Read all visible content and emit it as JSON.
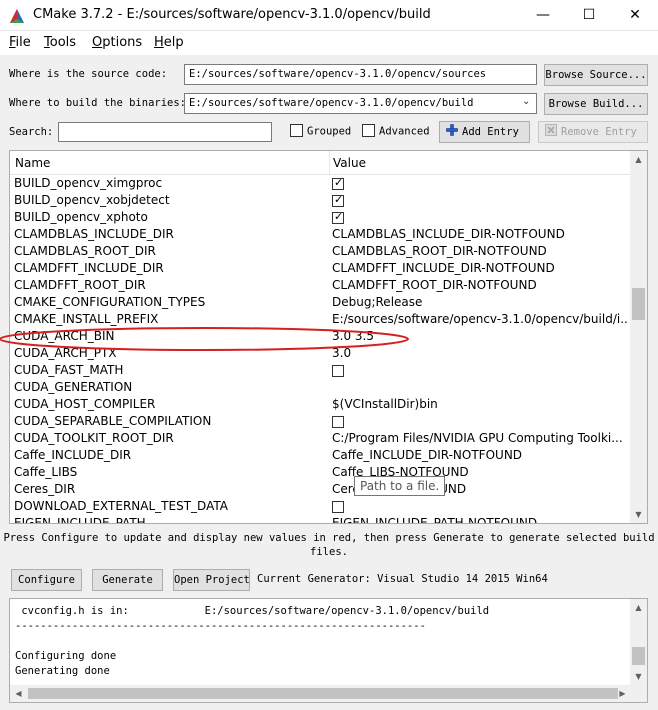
{
  "window": {
    "title": "CMake 3.7.2 - E:/sources/software/opencv-3.1.0/opencv/build",
    "minimize": "—",
    "maximize": "☐",
    "close": "✕"
  },
  "menu": {
    "items": [
      {
        "ul": "F",
        "rest": "ile"
      },
      {
        "ul": "T",
        "rest": "ools"
      },
      {
        "ul": "O",
        "rest": "ptions"
      },
      {
        "ul": "H",
        "rest": "elp"
      }
    ]
  },
  "source": {
    "label": "Where is the source code:",
    "value": "E:/sources/software/opencv-3.1.0/opencv/sources",
    "browse_label": "Browse Source..."
  },
  "build": {
    "label": "Where to build the binaries:",
    "value": "E:/sources/software/opencv-3.1.0/opencv/build",
    "browse_label": "Browse Build..."
  },
  "search": {
    "label": "Search:",
    "value": "",
    "grouped_label": "Grouped",
    "grouped_checked": false,
    "advanced_label": "Advanced",
    "advanced_checked": false,
    "add_entry_label": "Add Entry",
    "remove_entry_label": "Remove Entry"
  },
  "table": {
    "headers": {
      "name": "Name",
      "value": "Value"
    },
    "rows": [
      {
        "name": "BUILD_opencv_ximgproc",
        "type": "bool",
        "checked": true
      },
      {
        "name": "BUILD_opencv_xobjdetect",
        "type": "bool",
        "checked": true
      },
      {
        "name": "BUILD_opencv_xphoto",
        "type": "bool",
        "checked": true
      },
      {
        "name": "CLAMDBLAS_INCLUDE_DIR",
        "type": "text",
        "value": "CLAMDBLAS_INCLUDE_DIR-NOTFOUND"
      },
      {
        "name": "CLAMDBLAS_ROOT_DIR",
        "type": "text",
        "value": "CLAMDBLAS_ROOT_DIR-NOTFOUND"
      },
      {
        "name": "CLAMDFFT_INCLUDE_DIR",
        "type": "text",
        "value": "CLAMDFFT_INCLUDE_DIR-NOTFOUND"
      },
      {
        "name": "CLAMDFFT_ROOT_DIR",
        "type": "text",
        "value": "CLAMDFFT_ROOT_DIR-NOTFOUND"
      },
      {
        "name": "CMAKE_CONFIGURATION_TYPES",
        "type": "text",
        "value": "Debug;Release"
      },
      {
        "name": "CMAKE_INSTALL_PREFIX",
        "type": "text",
        "value": "E:/sources/software/opencv-3.1.0/opencv/build/i..."
      },
      {
        "name": "CUDA_ARCH_BIN",
        "type": "text",
        "value": "3.0 3.5"
      },
      {
        "name": "CUDA_ARCH_PTX",
        "type": "text",
        "value": "3.0"
      },
      {
        "name": "CUDA_FAST_MATH",
        "type": "bool",
        "checked": false
      },
      {
        "name": "CUDA_GENERATION",
        "type": "text",
        "value": ""
      },
      {
        "name": "CUDA_HOST_COMPILER",
        "type": "text",
        "value": "$(VCInstallDir)bin"
      },
      {
        "name": "CUDA_SEPARABLE_COMPILATION",
        "type": "bool",
        "checked": false
      },
      {
        "name": "CUDA_TOOLKIT_ROOT_DIR",
        "type": "text",
        "value": "C:/Program Files/NVIDIA GPU Computing Toolki..."
      },
      {
        "name": "Caffe_INCLUDE_DIR",
        "type": "text",
        "value": "Caffe_INCLUDE_DIR-NOTFOUND"
      },
      {
        "name": "Caffe_LIBS",
        "type": "text",
        "value": "Caffe_LIBS-NOTFOUND"
      },
      {
        "name": "Ceres_DIR",
        "type": "text",
        "value": "Ceres_DIR-NOTFOUND"
      },
      {
        "name": "DOWNLOAD_EXTERNAL_TEST_DATA",
        "type": "bool",
        "checked": false
      },
      {
        "name": "EIGEN_INCLUDE_PATH",
        "type": "text",
        "value": "EIGEN_INCLUDE_PATH-NOTFOUND"
      }
    ],
    "tooltip": "Path to a file."
  },
  "info_text_line1": "Press Configure to update and display new values in red, then press Generate to generate selected build",
  "info_text_line2": "files.",
  "actions": {
    "configure_label": "Configure",
    "generate_label": "Generate",
    "open_project_label": "Open Project",
    "generator_text": "Current Generator: Visual Studio 14 2015 Win64"
  },
  "output": {
    "lines": [
      " cvconfig.h is in:            E:/sources/software/opencv-3.1.0/opencv/build",
      "-----------------------------------------------------------------",
      "",
      "Configuring done",
      "Generating done"
    ]
  },
  "colors": {
    "highlight_ellipse": "#d42020",
    "scroll_thumb": "#c2c2c2"
  }
}
